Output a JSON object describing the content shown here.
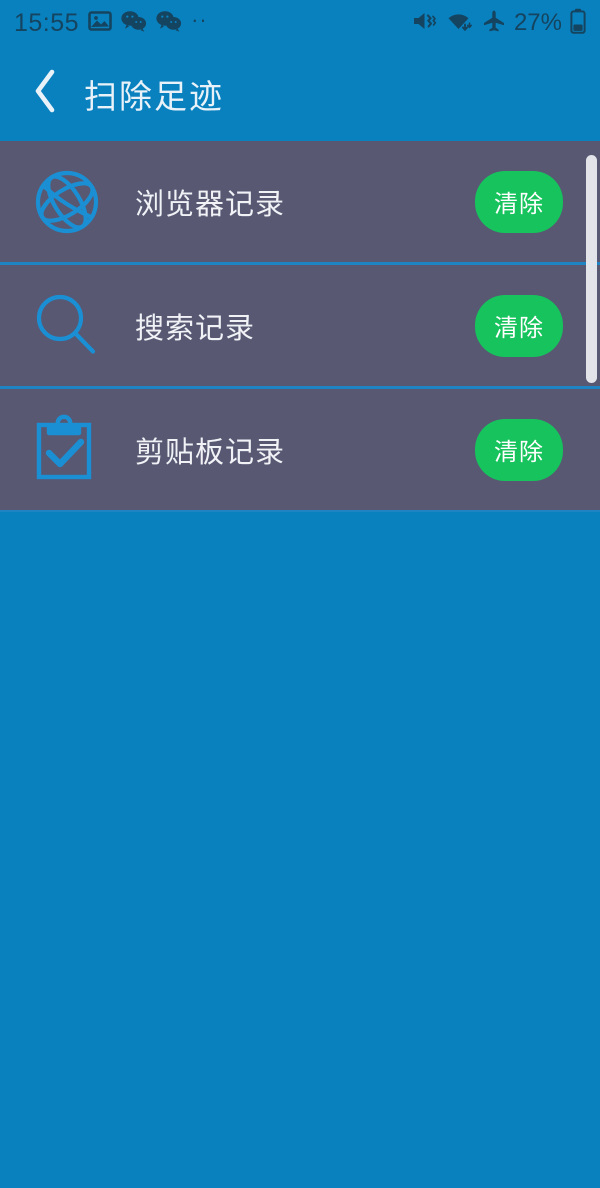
{
  "status_bar": {
    "time": "15:55",
    "left_icons": [
      "image-icon",
      "wechat-icon",
      "wechat-icon",
      "overflow-dots-icon"
    ],
    "overflow_dots": "··",
    "right_icons": [
      "mute-vibrate-icon",
      "wifi-icon",
      "airplane-mode-icon"
    ],
    "battery_percent": "27%",
    "battery_icon": "battery-icon",
    "text_color": "#14445f"
  },
  "app_bar": {
    "back_icon": "back-chevron-icon",
    "title": "扫除足迹",
    "background": "#0a81bf",
    "title_color": "#e8f2f8"
  },
  "list": {
    "background": "#585873",
    "divider_color": "#1f84c4",
    "icon_color": "#1a8fd4",
    "scrollbar_color": "#e2e4ea",
    "rows": [
      {
        "icon": "globe-icon",
        "label": "浏览器记录",
        "action_label": "清除"
      },
      {
        "icon": "search-icon",
        "label": "搜索记录",
        "action_label": "清除"
      },
      {
        "icon": "clipboard-check-icon",
        "label": "剪贴板记录",
        "action_label": "清除"
      }
    ]
  },
  "theme": {
    "page_background": "#0a81bf",
    "accent_green": "#16c35e",
    "row_background": "#585873"
  }
}
